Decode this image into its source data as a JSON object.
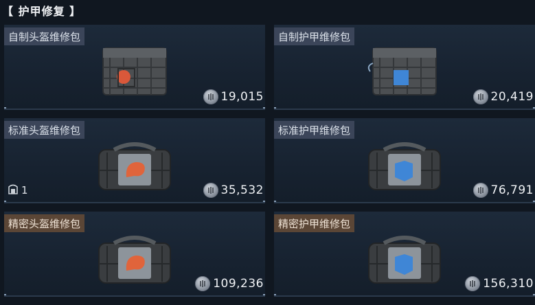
{
  "header": {
    "title": "【 护甲修复 】"
  },
  "items": [
    {
      "name": "自制头盔维修包",
      "price": "19,015",
      "tier": "grey",
      "kind": "pouch",
      "accent": "#d9583a"
    },
    {
      "name": "自制护甲维修包",
      "price": "20,419",
      "tier": "grey",
      "kind": "pouch",
      "accent": "#3f86d6"
    },
    {
      "name": "标准头盔维修包",
      "price": "35,532",
      "tier": "grey",
      "kind": "bag",
      "accent": "#e0643b",
      "owned": "1"
    },
    {
      "name": "标准护甲维修包",
      "price": "76,791",
      "tier": "grey",
      "kind": "bag",
      "accent": "#3f86d6"
    },
    {
      "name": "精密头盔维修包",
      "price": "109,236",
      "tier": "gold",
      "kind": "bag",
      "accent": "#e0643b"
    },
    {
      "name": "精密护甲维修包",
      "price": "156,310",
      "tier": "gold",
      "kind": "bag",
      "accent": "#3f86d6"
    }
  ],
  "icons": {
    "currency": "coin-icon",
    "owned": "storage-icon"
  }
}
